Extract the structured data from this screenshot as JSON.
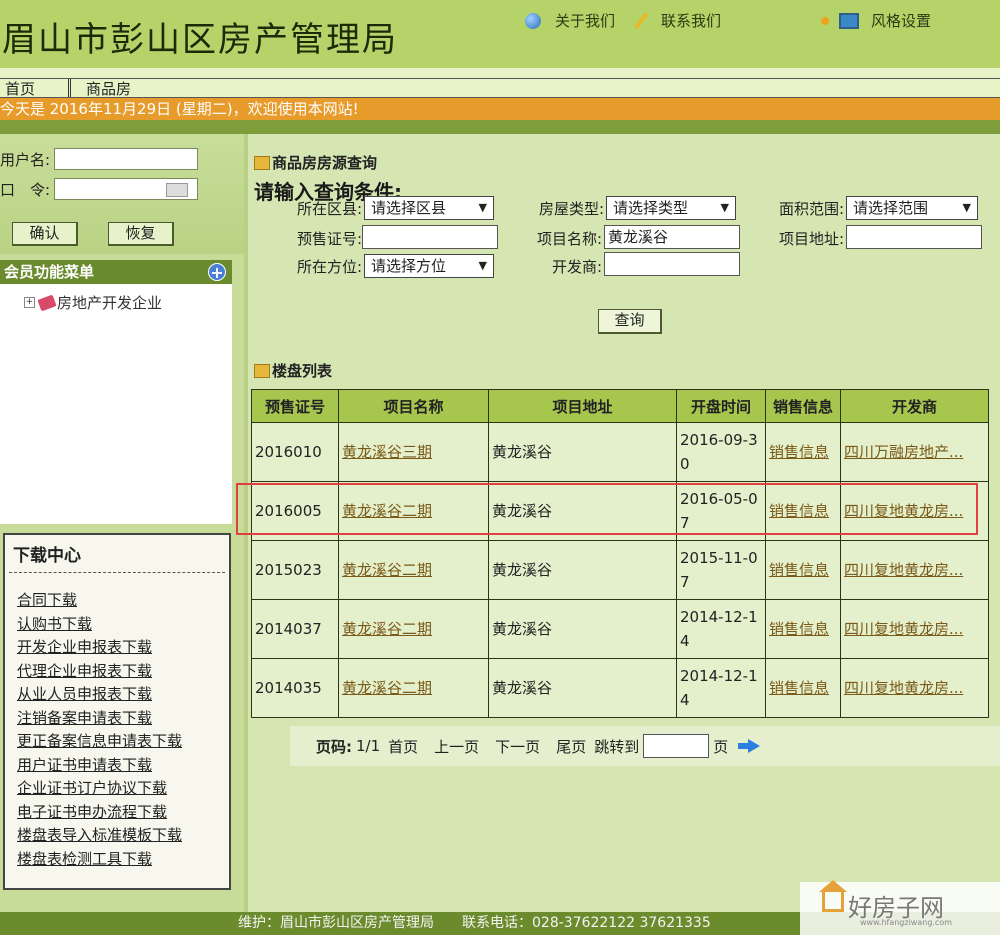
{
  "header": {
    "site_title": "眉山市彭山区房产管理局",
    "links": {
      "about": "关于我们",
      "contact": "联系我们",
      "style": "风格设置"
    }
  },
  "nav": {
    "items": [
      "首页",
      "商品房"
    ]
  },
  "ticker": "今天是 2016年11月29日 (星期二)，欢迎使用本网站!",
  "login": {
    "username_label": "用户名:",
    "password_label": "口　令:",
    "confirm": "确认",
    "reset": "恢复"
  },
  "member_menu": {
    "title": "会员功能菜单",
    "items": [
      "房地产开发企业"
    ]
  },
  "download": {
    "title": "下载中心",
    "items": [
      "合同下载",
      "认购书下载",
      "开发企业申报表下载",
      "代理企业申报表下载",
      "从业人员申报表下载",
      "注销备案申请表下载",
      "更正备案信息申请表下载",
      "用户证书申请表下载",
      "企业证书订户协议下载",
      "电子证书申办流程下载",
      "楼盘表导入标准模板下载",
      "楼盘表检测工具下载"
    ]
  },
  "query": {
    "section_title": "商品房房源查询",
    "heading": "请输入查询条件:",
    "district_label": "所在区县:",
    "district_value": "请选择区县",
    "type_label": "房屋类型:",
    "type_value": "请选择类型",
    "area_label": "面积范围:",
    "area_value": "请选择范围",
    "presale_label": "预售证号:",
    "presale_value": "",
    "project_label": "项目名称:",
    "project_value": "黄龙溪谷",
    "address_label": "项目地址:",
    "address_value": "",
    "direction_label": "所在方位:",
    "direction_value": "请选择方位",
    "developer_label": "开发商:",
    "developer_value": "",
    "search_button": "查询"
  },
  "listing": {
    "section_title": "楼盘列表",
    "columns": [
      "预售证号",
      "项目名称",
      "项目地址",
      "开盘时间",
      "销售信息",
      "开发商"
    ],
    "rows": [
      {
        "cert": "2016010",
        "name": "黄龙溪谷三期",
        "address": "黄龙溪谷",
        "date": "2016-09-30",
        "sales": "销售信息",
        "developer": "四川万融房地产..."
      },
      {
        "cert": "2016005",
        "name": "黄龙溪谷二期",
        "address": "黄龙溪谷",
        "date": "2016-05-07",
        "sales": "销售信息",
        "developer": "四川复地黄龙房..."
      },
      {
        "cert": "2015023",
        "name": "黄龙溪谷二期",
        "address": "黄龙溪谷",
        "date": "2015-11-07",
        "sales": "销售信息",
        "developer": "四川复地黄龙房..."
      },
      {
        "cert": "2014037",
        "name": "黄龙溪谷二期",
        "address": "黄龙溪谷",
        "date": "2014-12-14",
        "sales": "销售信息",
        "developer": "四川复地黄龙房..."
      },
      {
        "cert": "2014035",
        "name": "黄龙溪谷二期",
        "address": "黄龙溪谷",
        "date": "2014-12-14",
        "sales": "销售信息",
        "developer": "四川复地黄龙房..."
      }
    ]
  },
  "pager": {
    "label": "页码:",
    "current": "1/1",
    "first": "首页",
    "prev": "上一页",
    "next": "下一页",
    "last": "尾页",
    "jump": "跳转到",
    "page_unit": "页"
  },
  "footer": "维护：眉山市彭山区房产管理局　　联系电话：028-37622122  37621335",
  "watermark": {
    "text": "好房子网",
    "sub": "www.hfangziwang.com"
  }
}
